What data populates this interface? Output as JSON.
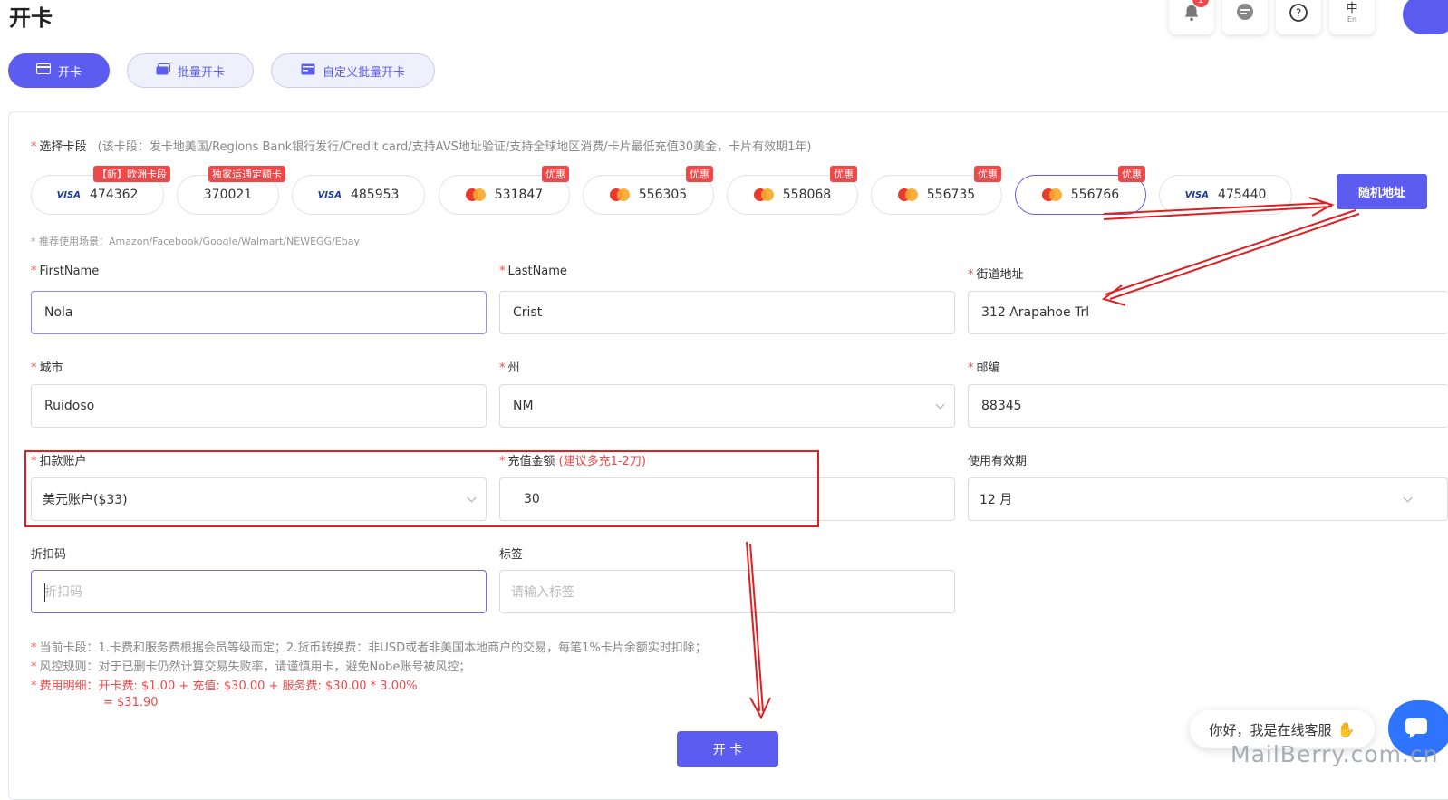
{
  "header": {
    "title": "开卡",
    "notification_badge": "1",
    "lang_main": "中",
    "lang_sub": "En"
  },
  "tabs": [
    {
      "label": "开卡",
      "icon": "card-icon"
    },
    {
      "label": "批量开卡",
      "icon": "cards-icon"
    },
    {
      "label": "自定义批量开卡",
      "icon": "card-edit-icon"
    }
  ],
  "card_select": {
    "label": "选择卡段",
    "hint": "(该卡段：发卡地美国/Regions Bank银行发行/Credit card/支持AVS地址验证/支持全球地区消费/卡片最低充值30美金，卡片有效期1年)",
    "cards": [
      {
        "brand": "visa",
        "number": "474362",
        "tag": "【新】欧洲卡段"
      },
      {
        "brand": "none",
        "number": "370021",
        "tag": "独家运通定额卡"
      },
      {
        "brand": "visa",
        "number": "485953",
        "tag": ""
      },
      {
        "brand": "mastercard",
        "number": "531847",
        "tag": "优惠"
      },
      {
        "brand": "mastercard",
        "number": "556305",
        "tag": "优惠"
      },
      {
        "brand": "mastercard",
        "number": "558068",
        "tag": "优惠"
      },
      {
        "brand": "mastercard",
        "number": "556735",
        "tag": "优惠"
      },
      {
        "brand": "mastercard",
        "number": "556766",
        "tag": "优惠"
      },
      {
        "brand": "visa",
        "number": "475440",
        "tag": ""
      }
    ],
    "visa_text": "VISA",
    "scenes": "* 推荐使用场景：Amazon/Facebook/Google/Walmart/NEWEGG/Ebay",
    "random_button": "随机地址"
  },
  "form": {
    "firstname_label": "FirstName",
    "firstname_value": "Nola",
    "lastname_label": "LastName",
    "lastname_value": "Crist",
    "street_label": "街道地址",
    "street_value": "312 Arapahoe Trl",
    "city_label": "城市",
    "city_value": "Ruidoso",
    "state_label": "州",
    "state_value": "NM",
    "zip_label": "邮编",
    "zip_value": "88345",
    "account_label": "扣款账户",
    "account_value": "美元账户($33)",
    "amount_label": "充值金额",
    "amount_hint": "(建议多充1-2刀)",
    "amount_value": "30",
    "validity_label": "使用有效期",
    "validity_value": "12 月",
    "discount_label": "折扣码",
    "discount_placeholder": "折扣码",
    "tag_label": "标签",
    "tag_placeholder": "请输入标签"
  },
  "notes": [
    "当前卡段：1.卡费和服务费根据会员等级而定；2.货币转换费：非USD或者非美国本地商户的交易，每笔1%卡片余额实时扣除；",
    "风控规则：对于已删卡仍然计算交易失败率，请谨慎用卡，避免Nobe账号被风控；",
    "费用明细：开卡费: $1.00 + 充值: $30.00 + 服务费: $30.00 * 3.00%",
    "= $31.90"
  ],
  "submit_label": "开 卡",
  "chat_greeting": "你好，我是在线客服",
  "watermark": "MailBerry.com.cn",
  "colors": {
    "accent": "#5c5cf0",
    "danger": "#f04848",
    "annotation": "#e02020"
  }
}
